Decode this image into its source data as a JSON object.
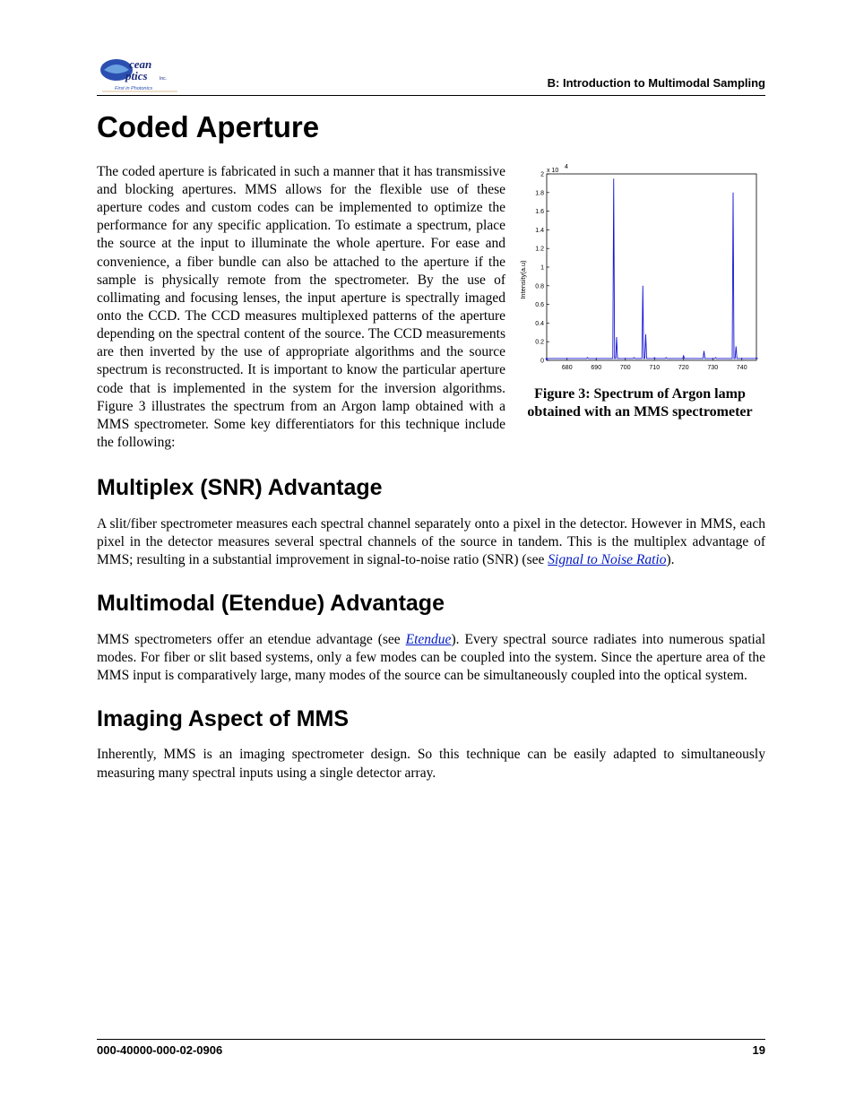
{
  "header": {
    "section_label": "B: Introduction to Multimodal Sampling",
    "logo_alt": "Ocean Optics Inc. First in Photonics"
  },
  "title_main": "Coded Aperture",
  "para_coded_aperture": "The coded aperture is fabricated in such a manner that it has transmissive and blocking apertures. MMS allows for the flexible use of these aperture codes and custom codes can be implemented to optimize the performance for any specific application. To estimate a spectrum, place the source at the input to illuminate the whole aperture. For ease and convenience, a fiber bundle can also be attached to the aperture if the sample is physically remote from the spectrometer. By the use of collimating and focusing lenses, the input aperture is spectrally imaged onto the CCD. The CCD measures multiplexed patterns of the aperture depending on the spectral content of the source. The CCD measurements are then inverted by the use of appropriate algorithms and the source spectrum is reconstructed. It is important to know the particular aperture code that is implemented in the system for the inversion algorithms. Figure 3 illustrates the spectrum from an Argon lamp obtained with a MMS spectrometer. Some key differentiators for this technique include the following:",
  "figure": {
    "caption": "Figure 3: Spectrum of Argon lamp obtained with an MMS spectrometer",
    "ylabel": "Intensity(a.u)",
    "exponent": "x 10",
    "exponent_sup": "4"
  },
  "section_multiplex": {
    "title": "Multiplex (SNR) Advantage",
    "para_pre": "A slit/fiber spectrometer measures each spectral channel separately onto a pixel in the detector. However in MMS, each pixel in the detector measures several spectral channels of the source in tandem. This is the multiplex advantage of MMS; resulting in a substantial improvement in signal-to-noise ratio (SNR) (see ",
    "link_text": "Signal to Noise Ratio",
    "para_post": ")."
  },
  "section_etendue": {
    "title": "Multimodal (Etendue) Advantage",
    "para_pre": "MMS spectrometers offer an etendue advantage (see ",
    "link_text": "Etendue",
    "para_post": "). Every spectral source radiates into numerous spatial modes. For fiber or slit based systems, only a few modes can be coupled into the system. Since the aperture area of the MMS input is comparatively large, many modes of the source can be simultaneously coupled into the optical system."
  },
  "section_imaging": {
    "title": "Imaging Aspect of MMS",
    "para": "Inherently, MMS is an imaging spectrometer design. So this technique can be easily adapted to simultaneously measuring many spectral inputs using a single detector array."
  },
  "footer": {
    "doc_number": "000-40000-000-02-0906",
    "page_number": "19"
  },
  "chart_data": {
    "type": "line",
    "title": "",
    "xlabel": "",
    "ylabel": "Intensity(a.u)",
    "y_exponent_label": "x 10^4",
    "xlim": [
      673,
      745
    ],
    "ylim": [
      0,
      2
    ],
    "xticks": [
      680,
      690,
      700,
      710,
      720,
      730,
      740
    ],
    "yticks": [
      0,
      0.2,
      0.4,
      0.6,
      0.8,
      1,
      1.2,
      1.4,
      1.6,
      1.8,
      2
    ],
    "series": [
      {
        "name": "Argon lamp spectrum",
        "x": [
          673,
          687,
          696,
          697,
          703,
          706,
          707,
          710,
          714,
          720,
          727,
          731,
          737,
          738,
          745
        ],
        "y": [
          0,
          0.03,
          1.95,
          0.25,
          0.03,
          0.8,
          0.28,
          0.03,
          0.03,
          0.05,
          0.1,
          0.03,
          1.8,
          0.15,
          0.03
        ]
      }
    ]
  }
}
